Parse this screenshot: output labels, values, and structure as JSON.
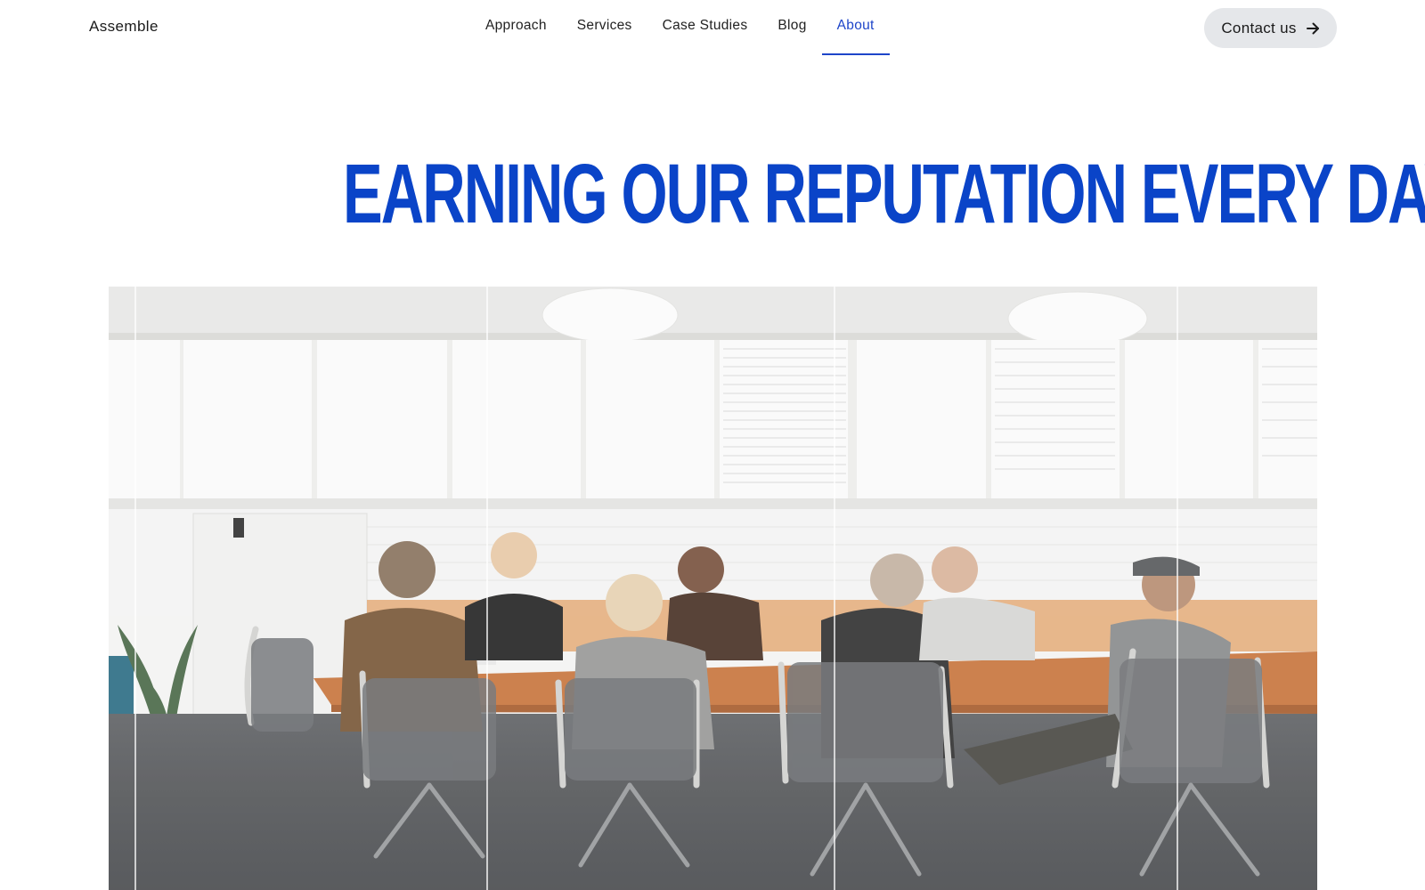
{
  "header": {
    "logo": "Assemble",
    "nav": [
      {
        "label": "Approach",
        "active": false
      },
      {
        "label": "Services",
        "active": false
      },
      {
        "label": "Case Studies",
        "active": false
      },
      {
        "label": "Blog",
        "active": false
      },
      {
        "label": "About",
        "active": true
      }
    ],
    "contact_label": "Contact us",
    "contact_icon": "arrow-right-icon"
  },
  "hero": {
    "title": "EARNING OUR REPUTATION EVERY DAY"
  },
  "colors": {
    "accent": "#0a44c8",
    "nav_active": "#1e45c9",
    "button_bg": "#e5e7ea",
    "text": "#1a1a1a"
  }
}
